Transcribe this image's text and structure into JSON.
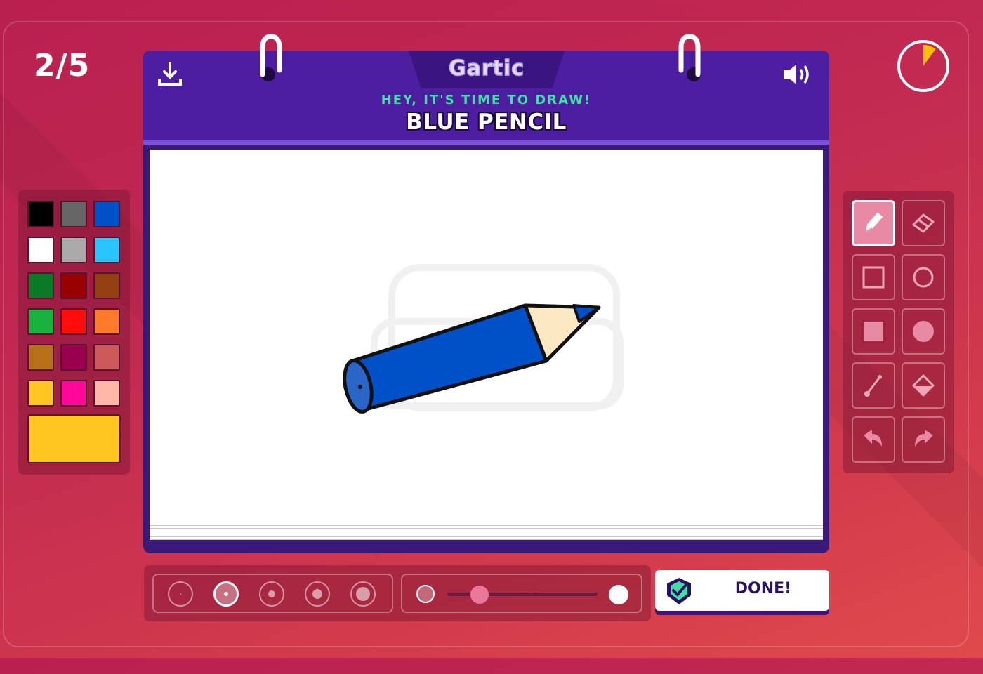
{
  "game": {
    "round": "2/5",
    "timer_remaining_fraction": 0.9,
    "logo": "Gartic",
    "prompt_label": "HEY, IT'S TIME TO DRAW!",
    "word": "BLUE PENCIL",
    "done_label": "DONE!"
  },
  "palette": {
    "colors": [
      "#000000",
      "#666666",
      "#0050c8",
      "#ffffff",
      "#aaaaaa",
      "#29c5ff",
      "#0b7a26",
      "#990000",
      "#954012",
      "#18b23e",
      "#ff0d0d",
      "#ff7a2a",
      "#b57019",
      "#99004d",
      "#cc5a5a",
      "#ffc41f",
      "#ff0899",
      "#ffb7a8"
    ],
    "selected": "#ffc41f"
  },
  "tools": [
    "pencil",
    "eraser",
    "rectangle-outline",
    "circle-outline",
    "rectangle-filled",
    "circle-filled",
    "line",
    "fill-bucket",
    "undo",
    "redo"
  ],
  "active_tool": "pencil",
  "brush": {
    "sizes": [
      1,
      2,
      3,
      4,
      5
    ],
    "selected_size": 2,
    "opacity_fraction": 0.12
  },
  "colors": {
    "accent": "#4d1ea0",
    "done_check": "#3ee0a6"
  }
}
